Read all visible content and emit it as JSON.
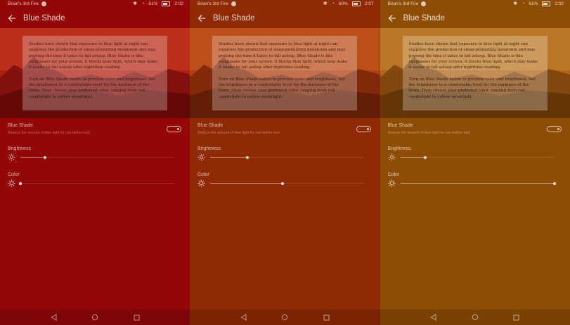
{
  "panels": [
    {
      "theme": "red",
      "bg": "#930707",
      "status": {
        "device": "Brian's 3rd Fire",
        "battery": "61%",
        "time": "2:02"
      },
      "appbar": {
        "title": "Blue Shade"
      },
      "card": {
        "p1": "Studies have shown that exposure to blue light at night can suppress the production of sleep-promoting melatonin and may prolong the time it takes to fall asleep. Blue Shade is like sunglasses for your screen; it blocks blue light, which may make it easier to fall asleep after nighttime reading.",
        "p2": "Turn on Blue Shade below to preview color and brightness. Set the brightness to a comfortable level for the darkness of the room. Then choose your preferred color, ranging from red candlelight to yellow moonlight."
      },
      "settings": {
        "blue_shade": {
          "title": "Blue Shade",
          "subtitle": "Reduce the amount of blue light for use before bed.",
          "enabled": true
        },
        "brightness": {
          "title": "Brightness",
          "value": 0.16
        },
        "color": {
          "title": "Color",
          "value": 0.0
        }
      }
    },
    {
      "theme": "orange",
      "bg": "#902a05",
      "status": {
        "device": "Brian's 3rd Fire",
        "battery": "60%",
        "time": "2:07"
      },
      "appbar": {
        "title": "Blue Shade"
      },
      "card": {
        "p1": "Studies have shown that exposure to blue light at night can suppress the production of sleep-promoting melatonin and may prolong the time it takes to fall asleep. Blue Shade is like sunglasses for your screen; it blocks blue light, which may make it easier to fall asleep after nighttime reading.",
        "p2": "Turn on Blue Shade below to preview color and brightness. Set the brightness to a comfortable level for the darkness of the room. Then choose your preferred color, ranging from red candlelight to yellow moonlight."
      },
      "settings": {
        "blue_shade": {
          "title": "Blue Shade",
          "subtitle": "Reduce the amount of blue light for use before bed.",
          "enabled": true
        },
        "brightness": {
          "title": "Brightness",
          "value": 0.24
        },
        "color": {
          "title": "Color",
          "value": 0.47
        }
      }
    },
    {
      "theme": "amber",
      "bg": "#8f4c05",
      "status": {
        "device": "Brian's 3rd Fire",
        "battery": "61%",
        "time": "2:02"
      },
      "appbar": {
        "title": "Blue Shade"
      },
      "card": {
        "p1": "Studies have shown that exposure to blue light at night can suppress the production of sleep-promoting melatonin and may prolong the time it takes to fall asleep. Blue Shade is like sunglasses for your screen; it blocks blue light, which may make it easier to fall asleep after nighttime reading.",
        "p2": "Turn on Blue Shade below to preview color and brightness. Set the brightness to a comfortable level for the darkness of the room. Then choose your preferred color, ranging from red candlelight to yellow moonlight."
      },
      "settings": {
        "blue_shade": {
          "title": "Blue Shade",
          "subtitle": "Reduce the amount of blue light for use before bed.",
          "enabled": true
        },
        "brightness": {
          "title": "Brightness",
          "value": 0.16
        },
        "color": {
          "title": "Color",
          "value": 1.0
        }
      }
    }
  ],
  "icons": {
    "back": "back-arrow-icon",
    "brightness": "sun-icon",
    "color": "color-dial-icon",
    "nav_back": "nav-back-icon",
    "nav_home": "nav-home-icon",
    "nav_recents": "nav-recents-icon",
    "status_bluetooth": "bluetooth-icon",
    "status_wifi": "wifi-icon",
    "status_battery": "battery-icon"
  }
}
